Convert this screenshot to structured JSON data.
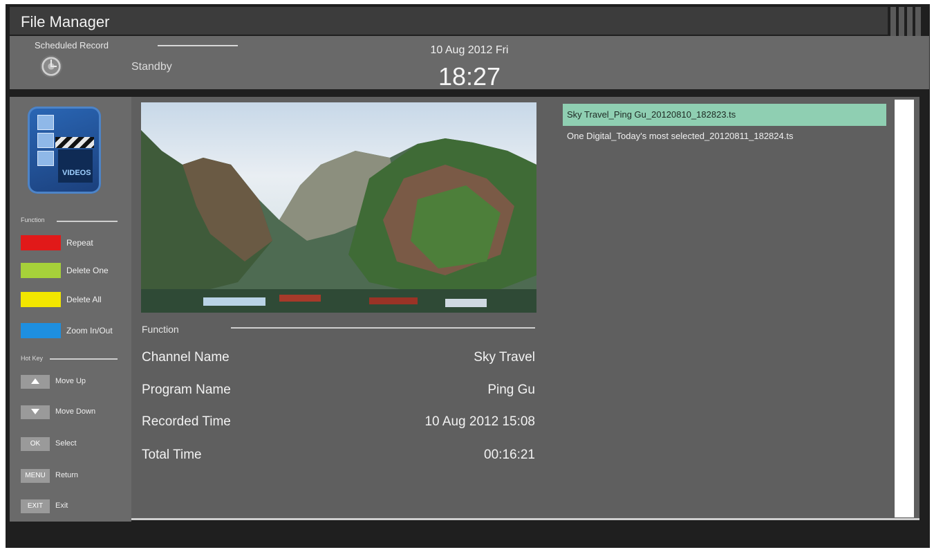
{
  "window": {
    "title": "File Manager"
  },
  "header": {
    "scheduled_record_label": "Scheduled Record",
    "status": "Standby",
    "date": "10 Aug 2012 Fri",
    "time": "18:27"
  },
  "sidebar": {
    "logo_text": "VIDEOS",
    "function_section": "Function",
    "function_keys": [
      {
        "color": "#e11919",
        "label": "Repeat"
      },
      {
        "color": "#a6d13a",
        "label": "Delete One"
      },
      {
        "color": "#f2e600",
        "label": "Delete All"
      },
      {
        "color": "#1e8fe0",
        "label": "Zoom In/Out"
      }
    ],
    "hotkey_section": "Hot Key",
    "hotkeys": [
      {
        "key": "",
        "icon": "up-arrow-icon",
        "label": "Move Up"
      },
      {
        "key": "",
        "icon": "down-arrow-icon",
        "label": "Move Down"
      },
      {
        "key": "OK",
        "label": "Select"
      },
      {
        "key": "MENU",
        "label": "Return"
      },
      {
        "key": "EXIT",
        "label": "Exit"
      }
    ]
  },
  "details": {
    "section_label": "Function",
    "rows": [
      {
        "key": "Channel Name",
        "value": "Sky Travel"
      },
      {
        "key": "Program Name",
        "value": "Ping Gu"
      },
      {
        "key": "Recorded Time",
        "value": "10 Aug 2012 15:08"
      },
      {
        "key": "Total Time",
        "value": "00:16:21"
      }
    ]
  },
  "files": [
    {
      "name": "Sky Travel_Ping Gu_20120810_182823.ts",
      "selected": true
    },
    {
      "name": "One Digital_Today's most selected_20120811_182824.ts",
      "selected": false
    }
  ],
  "colors": {
    "selected_row": "#8fcfb2",
    "panel": "#5f5f5f",
    "header": "#696969"
  }
}
